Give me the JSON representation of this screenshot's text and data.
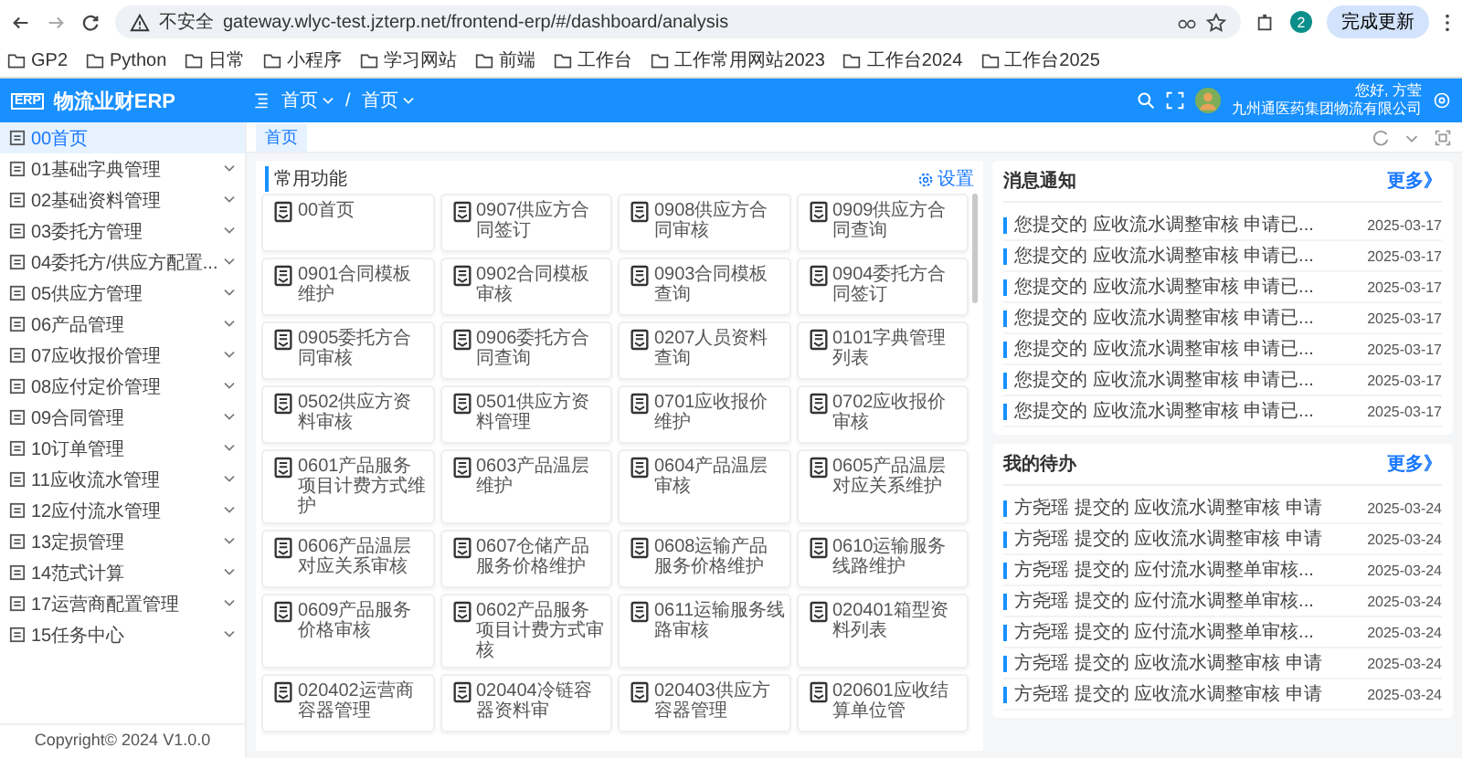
{
  "browser": {
    "security": "不安全",
    "url": "gateway.wlyc-test.jzterp.net/frontend-erp/#/dashboard/analysis",
    "profile": "2",
    "update_button": "完成更新",
    "bookmarks": [
      "GP2",
      "Python",
      "日常",
      "小程序",
      "学习网站",
      "前端",
      "工作台",
      "工作常用网站2023",
      "工作台2024",
      "工作台2025"
    ]
  },
  "header": {
    "logo": "ERP",
    "title": "物流业财ERP",
    "breadcrumbs": [
      "首页",
      "首页"
    ],
    "separator": "/",
    "greeting": "您好, 方莹",
    "company": "九州通医药集团物流有限公司"
  },
  "tabs": [
    {
      "label": "首页",
      "selected": true
    }
  ],
  "sidebar": {
    "items": [
      {
        "label": "00首页",
        "selected": true,
        "expandable": false
      },
      {
        "label": "01基础字典管理",
        "selected": false,
        "expandable": true
      },
      {
        "label": "02基础资料管理",
        "selected": false,
        "expandable": true
      },
      {
        "label": "03委托方管理",
        "selected": false,
        "expandable": true
      },
      {
        "label": "04委托方/供应方配置...",
        "selected": false,
        "expandable": true
      },
      {
        "label": "05供应方管理",
        "selected": false,
        "expandable": true
      },
      {
        "label": "06产品管理",
        "selected": false,
        "expandable": true
      },
      {
        "label": "07应收报价管理",
        "selected": false,
        "expandable": true
      },
      {
        "label": "08应付定价管理",
        "selected": false,
        "expandable": true
      },
      {
        "label": "09合同管理",
        "selected": false,
        "expandable": true
      },
      {
        "label": "10订单管理",
        "selected": false,
        "expandable": true
      },
      {
        "label": "11应收流水管理",
        "selected": false,
        "expandable": true
      },
      {
        "label": "12应付流水管理",
        "selected": false,
        "expandable": true
      },
      {
        "label": "13定损管理",
        "selected": false,
        "expandable": true
      },
      {
        "label": "14范式计算",
        "selected": false,
        "expandable": true
      },
      {
        "label": "17运营商配置管理",
        "selected": false,
        "expandable": true
      },
      {
        "label": "15任务中心",
        "selected": false,
        "expandable": true
      }
    ],
    "copyright": "Copyright© 2024 V1.0.0"
  },
  "functions": {
    "title": "常用功能",
    "settings": "设置",
    "items": [
      "00首页",
      "0907供应方合同签订",
      "0908供应方合同审核",
      "0909供应方合同查询",
      "0901合同模板维护",
      "0902合同模板审核",
      "0903合同模板查询",
      "0904委托方合同签订",
      "0905委托方合同审核",
      "0906委托方合同查询",
      "0207人员资料查询",
      "0101字典管理列表",
      "0502供应方资料审核",
      "0501供应方资料管理",
      "0701应收报价维护",
      "0702应收报价审核",
      "0601产品服务项目计费方式维护",
      "0603产品温层维护",
      "0604产品温层审核",
      "0605产品温层对应关系维护",
      "0606产品温层对应关系审核",
      "0607仓储产品服务价格维护",
      "0608运输产品服务价格维护",
      "0610运输服务线路维护",
      "0609产品服务价格审核",
      "0602产品服务项目计费方式审核",
      "0611运输服务线路审核",
      "020401箱型资料列表",
      "020402运营商容器管理",
      "020404冷链容器资料审",
      "020403供应方容器管理",
      "020601应收结算单位管"
    ]
  },
  "panels": [
    {
      "title": "消息通知",
      "more": "更多》",
      "items": [
        {
          "text": "您提交的 应收流水调整审核 申请已...",
          "date": "2025-03-17"
        },
        {
          "text": "您提交的 应收流水调整审核 申请已...",
          "date": "2025-03-17"
        },
        {
          "text": "您提交的 应收流水调整审核 申请已...",
          "date": "2025-03-17"
        },
        {
          "text": "您提交的 应收流水调整审核 申请已...",
          "date": "2025-03-17"
        },
        {
          "text": "您提交的 应收流水调整审核 申请已...",
          "date": "2025-03-17"
        },
        {
          "text": "您提交的 应收流水调整审核 申请已...",
          "date": "2025-03-17"
        },
        {
          "text": "您提交的 应收流水调整审核 申请已...",
          "date": "2025-03-17"
        }
      ]
    },
    {
      "title": "我的待办",
      "more": "更多》",
      "items": [
        {
          "text": "方尧瑶 提交的 应收流水调整审核 申请",
          "date": "2025-03-24"
        },
        {
          "text": "方尧瑶 提交的 应收流水调整审核 申请",
          "date": "2025-03-24"
        },
        {
          "text": "方尧瑶 提交的 应付流水调整单审核...",
          "date": "2025-03-24"
        },
        {
          "text": "方尧瑶 提交的 应付流水调整单审核...",
          "date": "2025-03-24"
        },
        {
          "text": "方尧瑶 提交的 应付流水调整单审核...",
          "date": "2025-03-24"
        },
        {
          "text": "方尧瑶 提交的 应收流水调整审核 申请",
          "date": "2025-03-24"
        },
        {
          "text": "方尧瑶 提交的 应收流水调整审核 申请",
          "date": "2025-03-24"
        }
      ]
    }
  ]
}
